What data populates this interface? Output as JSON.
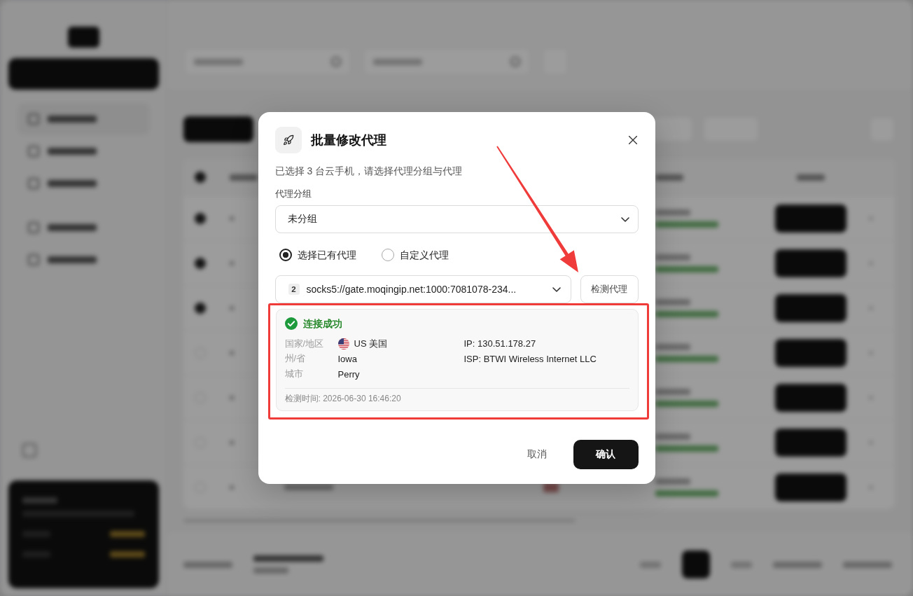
{
  "dialog": {
    "title": "批量修改代理",
    "subtitle": "已选择 3 台云手机，请选择代理分组与代理",
    "group_field": {
      "label": "代理分组",
      "value": "未分组"
    },
    "proxy_mode": [
      {
        "label": "选择已有代理",
        "selected": true
      },
      {
        "label": "自定义代理",
        "selected": false
      }
    ],
    "proxy_select": {
      "badge": "2",
      "value": "socks5://gate.moqingip.net:1000:7081078-234..."
    },
    "check_button": "检测代理",
    "result": {
      "success": true,
      "status": "连接成功",
      "details": [
        {
          "kind": "country",
          "label": "国家/地区",
          "value": "US 美国"
        },
        {
          "kind": "text",
          "label": "州/省",
          "value": "Iowa"
        },
        {
          "kind": "text",
          "label": "城市",
          "value": "Perry"
        }
      ],
      "connection": [
        "IP: 130.51.178.27",
        "ISP: BTWI Wireless Internet LLC"
      ],
      "checked_at": "检测时间: 2026-06-30 16:46:20"
    },
    "cancel_button": "取消",
    "confirm_button": "确认"
  }
}
